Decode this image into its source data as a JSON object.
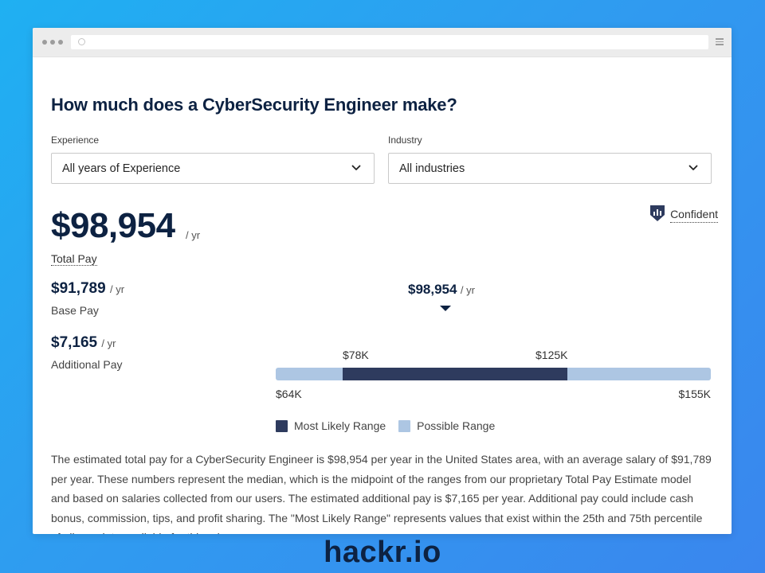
{
  "page": {
    "title": "How much does a CyberSecurity Engineer make?"
  },
  "filters": {
    "experience": {
      "label": "Experience",
      "value": "All years of Experience"
    },
    "industry": {
      "label": "Industry",
      "value": "All industries"
    }
  },
  "confidence": {
    "label": "Confident",
    "icon": "shield-chart-icon"
  },
  "pay": {
    "total": {
      "amount": "$98,954",
      "unit": "/ yr",
      "label": "Total Pay"
    },
    "base": {
      "amount": "$91,789",
      "unit": "/ yr",
      "label": "Base Pay"
    },
    "additional": {
      "amount": "$7,165",
      "unit": "/ yr",
      "label": "Additional Pay"
    }
  },
  "range": {
    "median_label": "$98,954",
    "median_unit": "/ yr",
    "median": 98954,
    "possible_min": 64000,
    "possible_max": 155000,
    "likely_min": 78000,
    "likely_max": 125000,
    "labels": {
      "possible_min": "$64K",
      "possible_max": "$155K",
      "likely_min": "$78K",
      "likely_max": "$125K"
    },
    "colors": {
      "likely": "#2e3b5e",
      "possible": "#adc6e3"
    }
  },
  "legend": {
    "likely": "Most Likely Range",
    "possible": "Possible Range"
  },
  "description": "The estimated total pay for a CyberSecurity Engineer is $98,954 per year in the United States area, with an average salary of $91,789 per year. These numbers represent the median, which is the midpoint of the ranges from our proprietary Total Pay Estimate model and based on salaries collected from our users. The estimated additional pay is $7,165 per year. Additional pay could include cash bonus, commission, tips, and profit sharing. The \"Most Likely Range\" represents values that exist within the 25th and 75th percentile of all pay data available for this role.",
  "brand": "hackr.io"
}
